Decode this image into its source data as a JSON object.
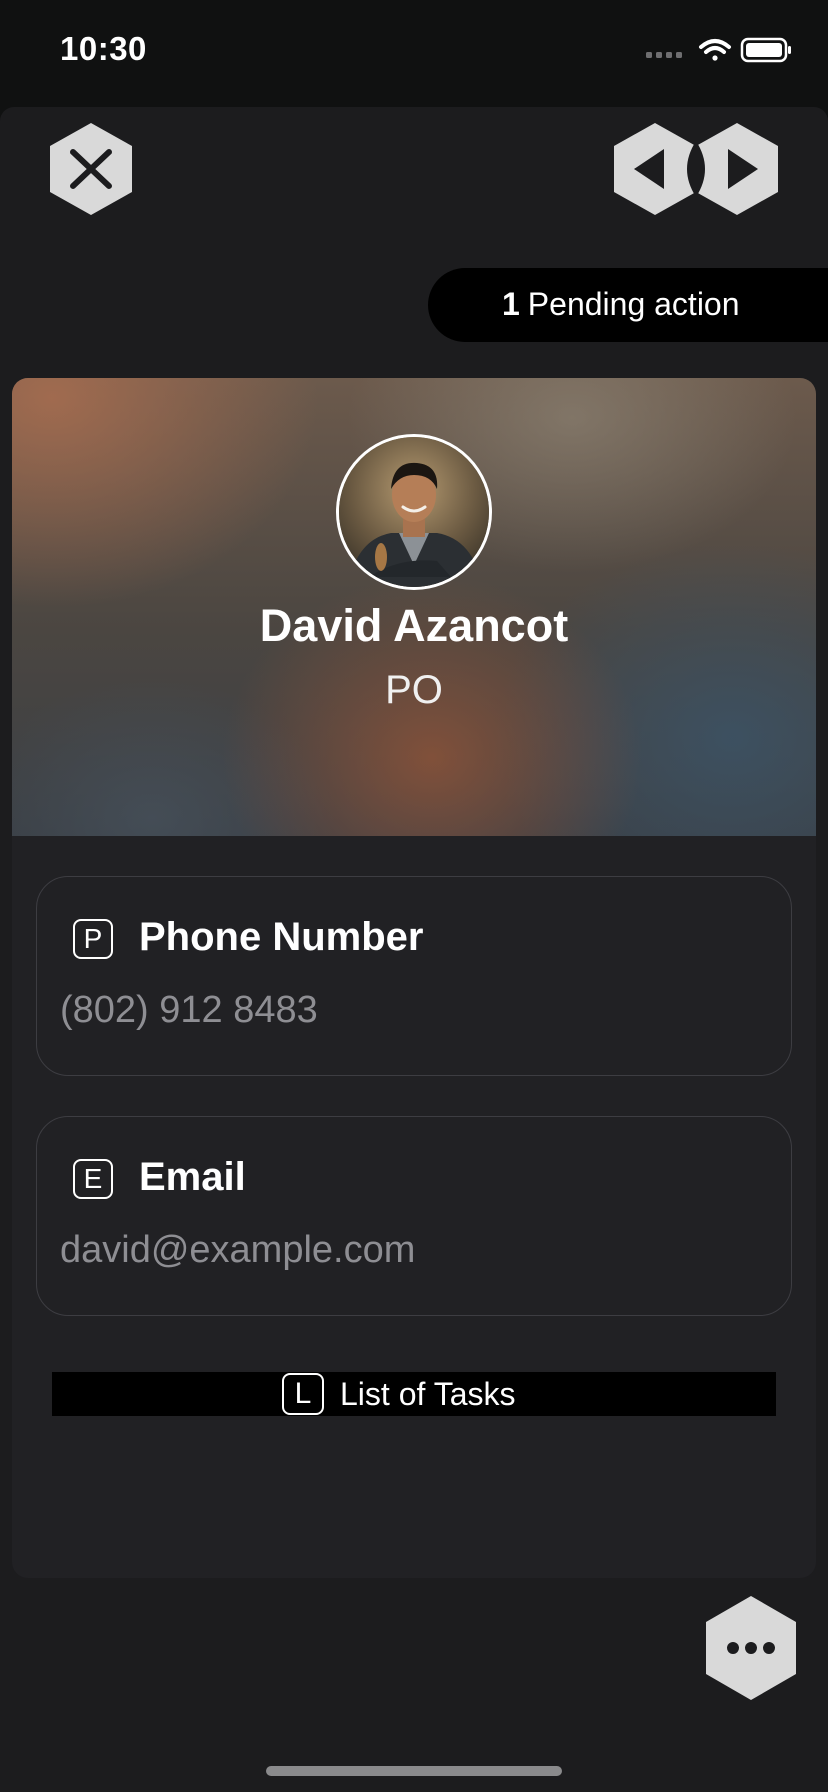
{
  "status_bar": {
    "time": "10:30",
    "signal_icon": "cellular-signal-icon",
    "wifi_icon": "wifi-icon",
    "battery_icon": "battery-icon"
  },
  "header": {
    "close_icon": "close-icon",
    "prev_icon": "chevron-left-icon",
    "next_icon": "chevron-right-icon"
  },
  "pending": {
    "count": "1",
    "label": "Pending action"
  },
  "profile": {
    "avatar_icon": "avatar",
    "name": "David Azancot",
    "role": "PO"
  },
  "fields": {
    "phone": {
      "key": "P",
      "label": "Phone Number",
      "value": "(802) 912 8483"
    },
    "email": {
      "key": "E",
      "label": "Email",
      "value": "david@example.com"
    }
  },
  "tasks": {
    "key": "L",
    "label": "List of Tasks"
  },
  "footer": {
    "more_icon": "more-icon"
  },
  "colors": {
    "background": "#101111",
    "sheet": "#1c1c1e",
    "card": "#212124",
    "button_fill": "#d9d9d9",
    "button_glyph": "#1c1c1e",
    "secondary_text": "#8e8e93"
  }
}
